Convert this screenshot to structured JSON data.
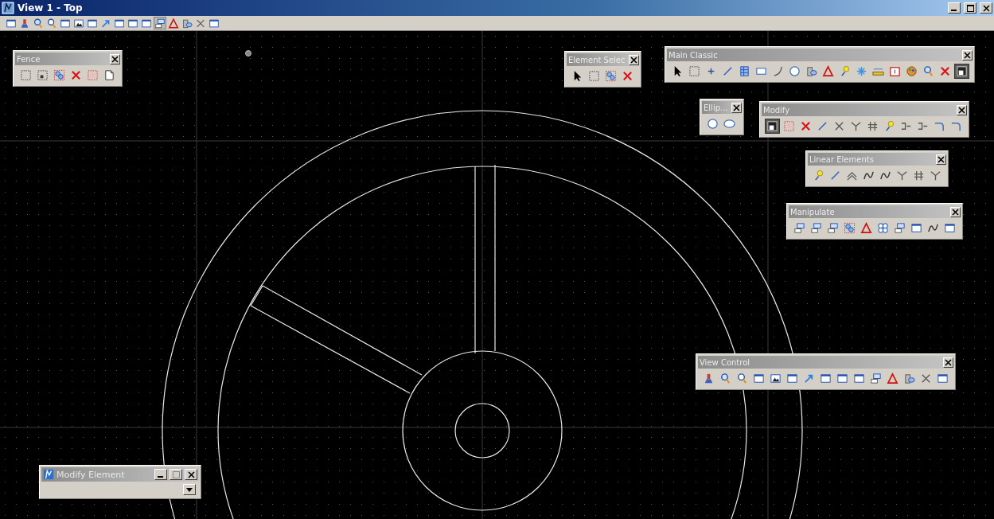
{
  "window": {
    "title": "View 1 - Top"
  },
  "view_toolbar": {
    "tools": [
      {
        "kind": "window",
        "selected": false
      },
      {
        "kind": "brush",
        "selected": false
      },
      {
        "kind": "zoom-in",
        "selected": false
      },
      {
        "kind": "zoom-out",
        "selected": false
      },
      {
        "kind": "window",
        "selected": false
      },
      {
        "kind": "picture",
        "selected": false
      },
      {
        "kind": "window",
        "selected": false
      },
      {
        "kind": "arrow",
        "selected": false
      },
      {
        "kind": "window",
        "selected": false
      },
      {
        "kind": "window",
        "selected": false
      },
      {
        "kind": "window",
        "selected": false
      },
      {
        "kind": "copy",
        "selected": true
      },
      {
        "kind": "triangle",
        "selected": false
      },
      {
        "kind": "cylinder",
        "selected": false
      },
      {
        "kind": "cross",
        "selected": false
      },
      {
        "kind": "window",
        "selected": false
      }
    ]
  },
  "palettes": [
    {
      "title": "Fence",
      "tools": [
        {
          "kind": "dashed-rect",
          "selected": false
        },
        {
          "kind": "dashed-block",
          "selected": false
        },
        {
          "kind": "dashed-circles",
          "selected": false
        },
        {
          "kind": "red-x",
          "selected": false
        },
        {
          "kind": "red-dashed",
          "selected": false
        },
        {
          "kind": "page",
          "selected": false
        }
      ]
    },
    {
      "title": "Element Selec",
      "tools": [
        {
          "kind": "pointer",
          "selected": false
        },
        {
          "kind": "dashed-rect",
          "selected": false
        },
        {
          "kind": "dashed-circles",
          "selected": false
        },
        {
          "kind": "red-x",
          "selected": false
        }
      ]
    },
    {
      "title": "Main Classic",
      "tools": [
        {
          "kind": "pointer",
          "selected": false
        },
        {
          "kind": "dashed-rect",
          "selected": false
        },
        {
          "kind": "point",
          "selected": false
        },
        {
          "kind": "line",
          "selected": false
        },
        {
          "kind": "hatch",
          "selected": false
        },
        {
          "kind": "rect",
          "selected": false
        },
        {
          "kind": "arc",
          "selected": false
        },
        {
          "kind": "circle",
          "selected": false
        },
        {
          "kind": "cylinder",
          "selected": false
        },
        {
          "kind": "triangle",
          "selected": false
        },
        {
          "kind": "bulb",
          "selected": false
        },
        {
          "kind": "star",
          "selected": false
        },
        {
          "kind": "ruler",
          "selected": false
        },
        {
          "kind": "frame",
          "selected": false
        },
        {
          "kind": "palette",
          "selected": false
        },
        {
          "kind": "zoom-in",
          "selected": false
        },
        {
          "kind": "red-x",
          "selected": false
        },
        {
          "kind": "pressed",
          "selected": true
        }
      ]
    },
    {
      "title": "Ellip...",
      "tools": [
        {
          "kind": "circle",
          "selected": false
        },
        {
          "kind": "ellipse",
          "selected": false
        }
      ]
    },
    {
      "title": "Modify",
      "tools": [
        {
          "kind": "pressed",
          "selected": true
        },
        {
          "kind": "red-dashed",
          "selected": false
        },
        {
          "kind": "red-x",
          "selected": false
        },
        {
          "kind": "line",
          "selected": false
        },
        {
          "kind": "cross",
          "selected": false
        },
        {
          "kind": "fork",
          "selected": false
        },
        {
          "kind": "hash",
          "selected": false
        },
        {
          "kind": "bulb",
          "selected": false
        },
        {
          "kind": "join",
          "selected": false
        },
        {
          "kind": "join",
          "selected": false
        },
        {
          "kind": "corner",
          "selected": false
        },
        {
          "kind": "corner",
          "selected": false
        }
      ]
    },
    {
      "title": "Linear Elements",
      "tools": [
        {
          "kind": "bulb",
          "selected": false
        },
        {
          "kind": "line",
          "selected": false
        },
        {
          "kind": "chevron",
          "selected": false
        },
        {
          "kind": "wave",
          "selected": false
        },
        {
          "kind": "wave",
          "selected": false
        },
        {
          "kind": "fork",
          "selected": false
        },
        {
          "kind": "hash",
          "selected": false
        },
        {
          "kind": "fork",
          "selected": false
        }
      ]
    },
    {
      "title": "Manipulate",
      "tools": [
        {
          "kind": "copy",
          "selected": false
        },
        {
          "kind": "copy",
          "selected": false
        },
        {
          "kind": "copy",
          "selected": false
        },
        {
          "kind": "dashed-circles",
          "selected": false
        },
        {
          "kind": "triangle",
          "selected": false
        },
        {
          "kind": "circles",
          "selected": false
        },
        {
          "kind": "copy",
          "selected": false
        },
        {
          "kind": "window",
          "selected": false
        },
        {
          "kind": "wave",
          "selected": false
        },
        {
          "kind": "window",
          "selected": false
        }
      ]
    },
    {
      "title": "View Control",
      "tools": [
        {
          "kind": "brush",
          "selected": false
        },
        {
          "kind": "zoom-in",
          "selected": false
        },
        {
          "kind": "zoom-out",
          "selected": false
        },
        {
          "kind": "window",
          "selected": false
        },
        {
          "kind": "picture",
          "selected": false
        },
        {
          "kind": "window",
          "selected": false
        },
        {
          "kind": "arrow",
          "selected": false
        },
        {
          "kind": "window",
          "selected": false
        },
        {
          "kind": "window",
          "selected": false
        },
        {
          "kind": "window",
          "selected": false
        },
        {
          "kind": "copy",
          "selected": false
        },
        {
          "kind": "triangle",
          "selected": false
        },
        {
          "kind": "cylinder",
          "selected": false
        },
        {
          "kind": "cross",
          "selected": false
        },
        {
          "kind": "window",
          "selected": false
        }
      ]
    }
  ],
  "modify_element": {
    "title": "Modify Element"
  }
}
